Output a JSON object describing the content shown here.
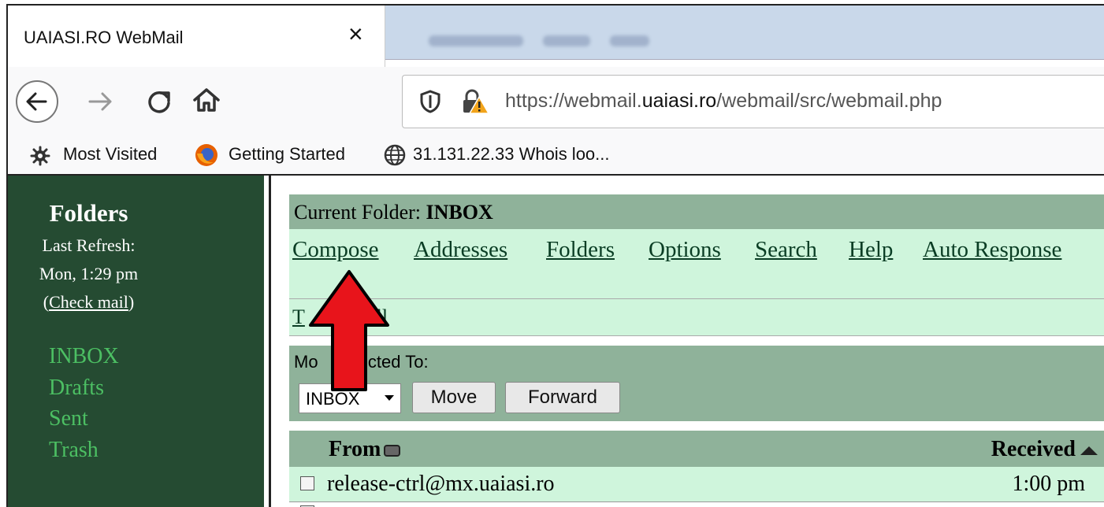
{
  "browser": {
    "tab_title": "UAIASI.RO WebMail",
    "tab_close": "×",
    "url_prefix": "https://webmail.",
    "url_domain": "uaiasi.ro",
    "url_path": "/webmail/src/webmail.php",
    "bookmarks": [
      {
        "label": "Most Visited",
        "icon": "gear-icon"
      },
      {
        "label": "Getting Started",
        "icon": "firefox-icon"
      },
      {
        "label": "31.131.22.33 Whois loo...",
        "icon": "globe-icon"
      }
    ]
  },
  "sidebar": {
    "title": "Folders",
    "last_refresh_label": "Last Refresh:",
    "last_refresh_time": "Mon, 1:29 pm",
    "check_mail_open": "(",
    "check_mail": "Check mail",
    "check_mail_close": ")",
    "folders": [
      "INBOX",
      "Drafts",
      "Sent",
      "Trash"
    ]
  },
  "main": {
    "current_folder_label": "Current Folder:",
    "current_folder": "INBOX",
    "nav": [
      "Compose",
      "Addresses",
      "Folders",
      "Options",
      "Search",
      "Help",
      "Auto Response"
    ],
    "toggle_left": "T",
    "toggle_right": "All",
    "move_label_left": "Mo",
    "move_label_right": "elected To:",
    "move_select_value": "INBOX",
    "move_button": "Move",
    "forward_button": "Forward",
    "columns": {
      "from": "From",
      "received": "Received"
    },
    "rows": [
      {
        "from": "release-ctrl@mx.uaiasi.ro",
        "received": "1:00 pm"
      }
    ]
  },
  "colors": {
    "sidebar_bg": "#254b32",
    "folder_link": "#4cbf63",
    "header_bar": "#8fb29a",
    "light_row": "#cff5dc",
    "arrow": "#e8141b"
  }
}
